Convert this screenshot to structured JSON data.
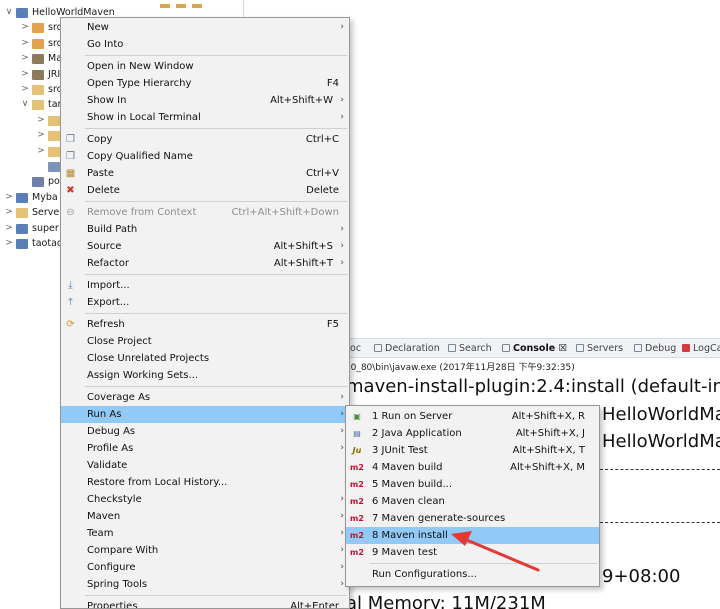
{
  "explorer": {
    "rows": [
      {
        "twisty": "∨",
        "label": "HelloWorldMaven",
        "icon_color": "#5a7fb8"
      },
      {
        "twisty": ">",
        "label": "src",
        "icon_color": "#e0a24a"
      },
      {
        "twisty": ">",
        "label": "src",
        "icon_color": "#e0a24a"
      },
      {
        "twisty": ">",
        "label": "Ma",
        "icon_color": "#8c7b5a"
      },
      {
        "twisty": ">",
        "label": "JRI",
        "icon_color": "#8c7b5a"
      },
      {
        "twisty": ">",
        "label": "src",
        "icon_color": "#e3c277"
      },
      {
        "twisty": "∨",
        "label": "tar",
        "icon_color": "#e3c277"
      },
      {
        "twisty": ">",
        "label": "",
        "icon_color": "#e3c277"
      },
      {
        "twisty": ">",
        "label": "",
        "icon_color": "#e3c277"
      },
      {
        "twisty": ">",
        "label": "",
        "icon_color": "#e3c277"
      },
      {
        "twisty": "",
        "label": "",
        "icon_color": "#7d93b8"
      },
      {
        "twisty": "",
        "label": "po",
        "icon_color": "#6f7fa8"
      },
      {
        "twisty": ">",
        "label": "Myba",
        "icon_color": "#5a7fb8"
      },
      {
        "twisty": ">",
        "label": "Server",
        "icon_color": "#e3c277"
      },
      {
        "twisty": ">",
        "label": "super",
        "icon_color": "#5a7fb8"
      },
      {
        "twisty": ">",
        "label": "taotao",
        "icon_color": "#5a7fb8"
      }
    ]
  },
  "console": {
    "tabs": [
      {
        "label": "doc"
      },
      {
        "label": "Declaration"
      },
      {
        "label": "Search"
      },
      {
        "label": "Console ☒",
        "active": true
      },
      {
        "label": "Servers"
      },
      {
        "label": "Debug"
      },
      {
        "label": "LogCa"
      }
    ],
    "command": "7.0_80\\bin\\javaw.exe (2017年11月28日 下午9:32:35)",
    "lines": [
      "maven-install-plugin:2.4:install (default-inst",
      "HelloWorldMa",
      "HelloWorldMa",
      "9+08:00",
      "al Memory: 11M/231M"
    ]
  },
  "context_menu": {
    "items": [
      {
        "label": "New",
        "submenu": true
      },
      {
        "label": "Go Into"
      },
      {
        "separator": true
      },
      {
        "label": "Open in New Window"
      },
      {
        "label": "Open Type Hierarchy",
        "shortcut": "F4"
      },
      {
        "label": "Show In",
        "shortcut": "Alt+Shift+W",
        "submenu": true
      },
      {
        "label": "Show in Local Terminal",
        "submenu": true
      },
      {
        "separator": true
      },
      {
        "label": "Copy",
        "shortcut": "Ctrl+C",
        "icon": "copy-icon"
      },
      {
        "label": "Copy Qualified Name",
        "icon": "copy-qualified-icon"
      },
      {
        "label": "Paste",
        "shortcut": "Ctrl+V",
        "icon": "paste-icon"
      },
      {
        "label": "Delete",
        "shortcut": "Delete",
        "icon": "delete-icon"
      },
      {
        "separator": true
      },
      {
        "label": "Remove from Context",
        "shortcut": "Ctrl+Alt+Shift+Down",
        "disabled": true,
        "icon": "remove-context-icon"
      },
      {
        "label": "Build Path",
        "submenu": true
      },
      {
        "label": "Source",
        "shortcut": "Alt+Shift+S",
        "submenu": true
      },
      {
        "label": "Refactor",
        "shortcut": "Alt+Shift+T",
        "submenu": true
      },
      {
        "separator": true
      },
      {
        "label": "Import...",
        "icon": "import-icon"
      },
      {
        "label": "Export...",
        "icon": "export-icon"
      },
      {
        "separator": true
      },
      {
        "label": "Refresh",
        "shortcut": "F5",
        "icon": "refresh-icon"
      },
      {
        "label": "Close Project"
      },
      {
        "label": "Close Unrelated Projects"
      },
      {
        "label": "Assign Working Sets..."
      },
      {
        "separator": true
      },
      {
        "label": "Coverage As",
        "submenu": true
      },
      {
        "label": "Run As",
        "submenu": true,
        "highlighted": true
      },
      {
        "label": "Debug As",
        "submenu": true
      },
      {
        "label": "Profile As",
        "submenu": true
      },
      {
        "label": "Validate"
      },
      {
        "label": "Restore from Local History..."
      },
      {
        "label": "Checkstyle",
        "submenu": true
      },
      {
        "label": "Maven",
        "submenu": true
      },
      {
        "label": "Team",
        "submenu": true
      },
      {
        "label": "Compare With",
        "submenu": true
      },
      {
        "label": "Configure",
        "submenu": true
      },
      {
        "label": "Spring Tools",
        "submenu": true
      },
      {
        "separator": true
      },
      {
        "label": "Properties",
        "shortcut": "Alt+Enter"
      }
    ]
  },
  "run_as_menu": {
    "items": [
      {
        "label": "1 Run on Server",
        "shortcut": "Alt+Shift+X, R",
        "icon": "run-on-server-icon",
        "icon_text": "▣"
      },
      {
        "label": "2 Java Application",
        "shortcut": "Alt+Shift+X, J",
        "icon": "java-application-icon",
        "icon_text": "▤"
      },
      {
        "label": "3 JUnit Test",
        "shortcut": "Alt+Shift+X, T",
        "icon": "junit-icon",
        "icon_text": "Ju"
      },
      {
        "label": "4 Maven build",
        "shortcut": "Alt+Shift+X, M",
        "icon": "maven-m2-icon",
        "icon_text": "m2"
      },
      {
        "label": "5 Maven build...",
        "icon": "maven-m2-icon",
        "icon_text": "m2"
      },
      {
        "label": "6 Maven clean",
        "icon": "maven-m2-icon",
        "icon_text": "m2"
      },
      {
        "label": "7 Maven generate-sources",
        "icon": "maven-m2-icon",
        "icon_text": "m2"
      },
      {
        "label": "8 Maven install",
        "icon": "maven-m2-icon",
        "icon_text": "m2",
        "highlighted": true
      },
      {
        "label": "9 Maven test",
        "icon": "maven-m2-icon",
        "icon_text": "m2"
      },
      {
        "separator": true
      },
      {
        "label": "Run Configurations..."
      }
    ]
  },
  "colors": {
    "highlight": "#91c9f7",
    "annotation_arrow": "#e53935",
    "maven_icon": "#c8102e"
  }
}
